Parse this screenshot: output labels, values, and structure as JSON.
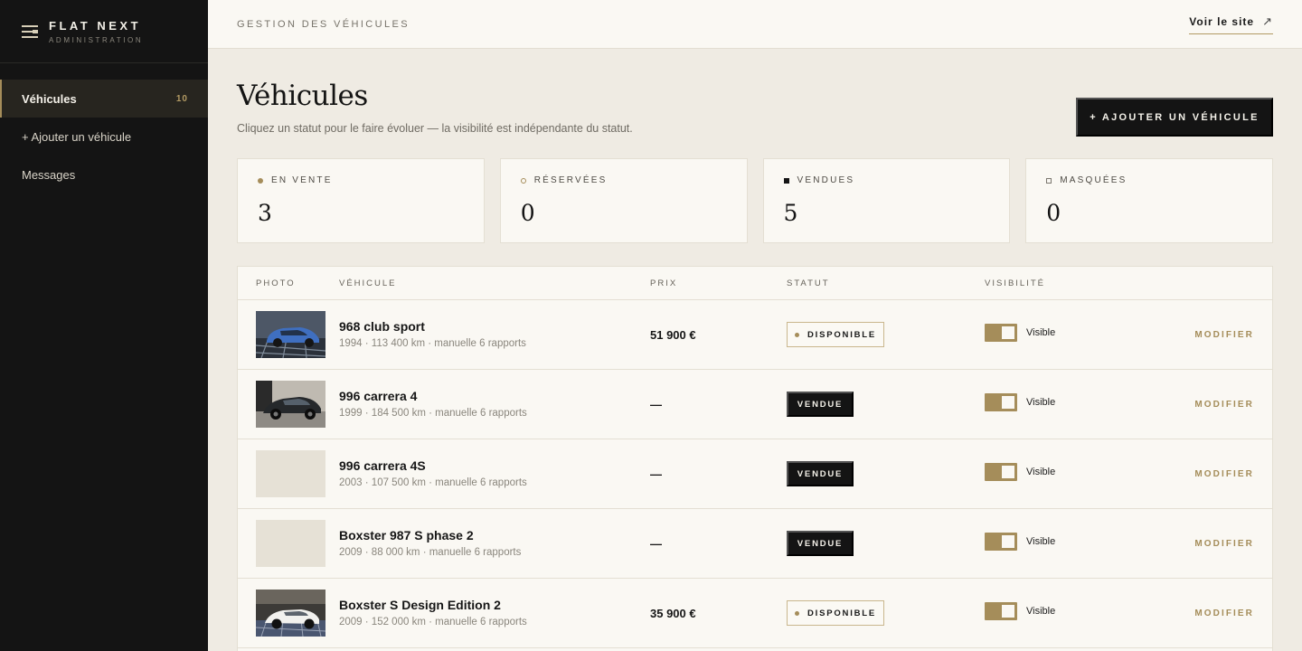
{
  "brand": {
    "name": "FLAT NEXT",
    "subtitle": "ADMINISTRATION"
  },
  "sidebar": {
    "items": [
      {
        "label": "Véhicules",
        "count": "10"
      },
      {
        "label": "+ Ajouter un véhicule"
      },
      {
        "label": "Messages"
      }
    ]
  },
  "topbar": {
    "section": "GESTION DES VÉHICULES",
    "site_link": "Voir le site",
    "site_icon": "↗"
  },
  "page": {
    "title": "Véhicules",
    "subtitle": "Cliquez un statut pour le faire évoluer — la visibilité est indépendante du statut.",
    "add_button": "+ AJOUTER UN VÉHICULE"
  },
  "stats": [
    {
      "label": "EN VENTE",
      "value": "3"
    },
    {
      "label": "RÉSERVÉES",
      "value": "0"
    },
    {
      "label": "VENDUES",
      "value": "5"
    },
    {
      "label": "MASQUÉES",
      "value": "0"
    }
  ],
  "table": {
    "headers": {
      "photo": "PHOTO",
      "vehicle": "VÉHICULE",
      "price": "PRIX",
      "status": "STATUT",
      "visibility": "VISIBILITÉ"
    },
    "edit_label": "MODIFIER",
    "rows": [
      {
        "name": "968 club sport",
        "meta": "1994 · 113 400 km · manuelle 6 rapports",
        "price": "51 900 €",
        "status": "DISPONIBLE",
        "visibility": "Visible",
        "photo": "blue"
      },
      {
        "name": "996 carrera 4",
        "meta": "1999 · 184 500 km · manuelle 6 rapports",
        "price": "—",
        "status": "VENDUE",
        "visibility": "Visible",
        "photo": "dark"
      },
      {
        "name": "996 carrera 4S",
        "meta": "2003 · 107 500 km · manuelle 6 rapports",
        "price": "—",
        "status": "VENDUE",
        "visibility": "Visible",
        "photo": "none"
      },
      {
        "name": "Boxster 987 S phase 2",
        "meta": "2009 · 88 000 km · manuelle 6 rapports",
        "price": "—",
        "status": "VENDUE",
        "visibility": "Visible",
        "photo": "none"
      },
      {
        "name": "Boxster S Design Edition 2",
        "meta": "2009 · 152 000 km · manuelle 6 rapports",
        "price": "35 900 €",
        "status": "DISPONIBLE",
        "visibility": "Visible",
        "photo": "white"
      }
    ]
  }
}
